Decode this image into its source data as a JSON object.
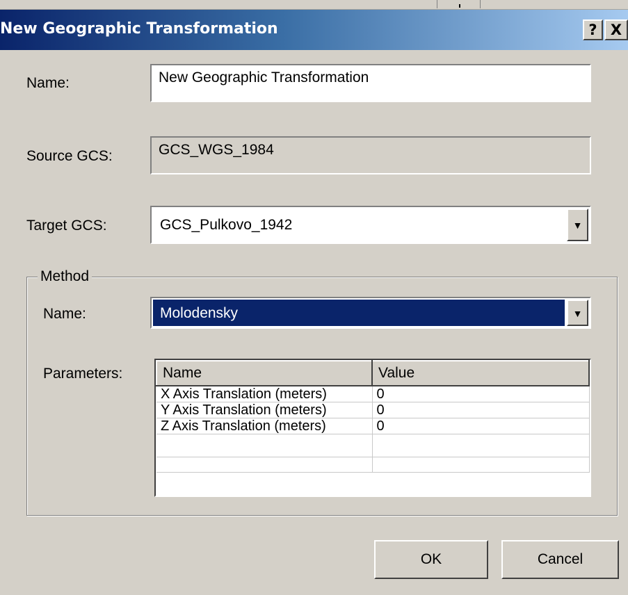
{
  "window": {
    "title": "New Geographic Transformation",
    "help_button": "?",
    "close_button": "X"
  },
  "name_field": {
    "label": "Name:",
    "value": "New Geographic Transformation"
  },
  "source_gcs": {
    "label": "Source GCS:",
    "value": "GCS_WGS_1984"
  },
  "target_gcs": {
    "label": "Target GCS:",
    "value": "GCS_Pulkovo_1942",
    "arrow": "▼"
  },
  "method": {
    "group_label": "Method",
    "name_label": "Name:",
    "name_value": "Molodensky",
    "arrow": "▼",
    "parameters_label": "Parameters:",
    "columns": [
      "Name",
      "Value"
    ],
    "rows": [
      {
        "name": "X Axis Translation (meters)",
        "value": "0"
      },
      {
        "name": "Y Axis Translation (meters)",
        "value": "0"
      },
      {
        "name": "Z Axis Translation (meters)",
        "value": "0"
      }
    ]
  },
  "buttons": {
    "ok": "OK",
    "cancel": "Cancel"
  },
  "colors": {
    "face": "#d4d0c8",
    "title_start": "#0a246a",
    "selection": "#0a246a"
  }
}
